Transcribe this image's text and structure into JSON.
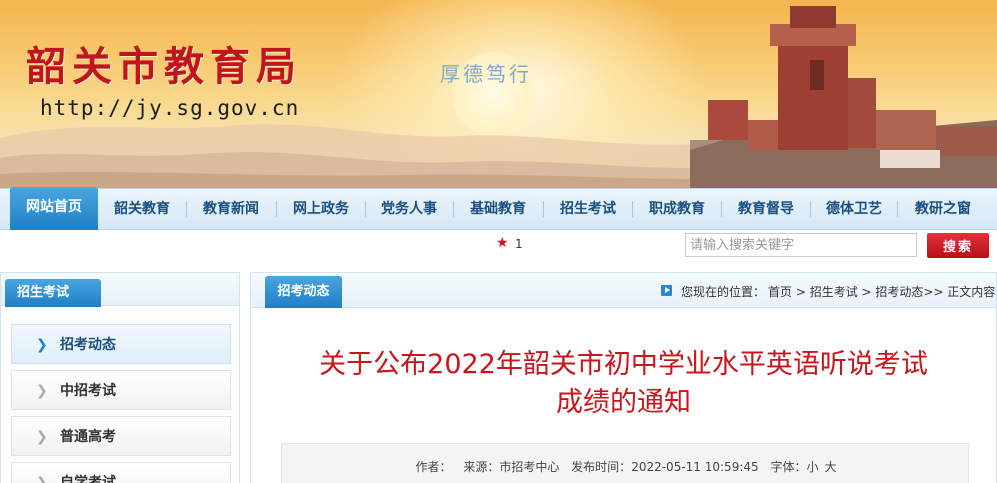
{
  "banner": {
    "title": "韶关市教育局",
    "url": "http://jy.sg.gov.cn",
    "motto": "厚德笃行"
  },
  "nav": {
    "items": [
      "网站首页",
      "韶关教育",
      "教育新闻",
      "网上政务",
      "党务人事",
      "基础教育",
      "招生考试",
      "职成教育",
      "教育督导",
      "德体卫艺",
      "教研之窗"
    ]
  },
  "toolbar": {
    "star_icon": "star-icon",
    "star_count": "1",
    "search_placeholder": "请输入搜索关键字",
    "search_button": "搜索"
  },
  "sidebar": {
    "title": "招生考试",
    "items": [
      {
        "label": "招考动态",
        "active": true
      },
      {
        "label": "中招考试",
        "active": false
      },
      {
        "label": "普通高考",
        "active": false
      },
      {
        "label": "自学考试",
        "active": false
      }
    ]
  },
  "main": {
    "tab": "招考动态",
    "breadcrumb": {
      "prefix": "您现在的位置：",
      "path": "首页 > 招生考试 > 招考动态>> 正文内容"
    },
    "article_title_line1": "关于公布2022年韶关市初中学业水平英语听说考试",
    "article_title_line2": "成绩的通知",
    "meta": {
      "author_label": "作者：",
      "source_label": "来源：",
      "source": "市招考中心",
      "date_label": "发布时间：",
      "date": "2022-05-11 10:59:45",
      "font_label": "字体：",
      "font_small": "小",
      "font_large": "大"
    }
  },
  "colors": {
    "brand_red": "#c2141c",
    "nav_blue": "#1f7fc6",
    "title_red": "#c9161d"
  }
}
